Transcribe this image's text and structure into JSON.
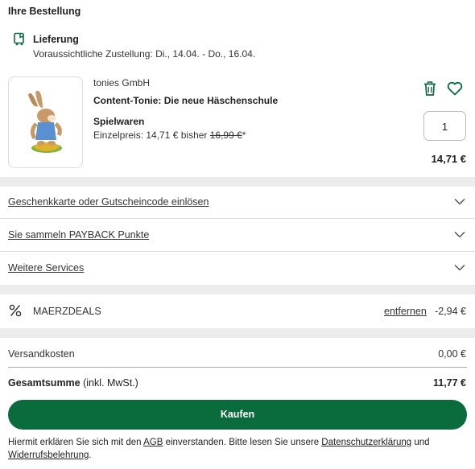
{
  "order": {
    "title": "Ihre Bestellung",
    "delivery_title": "Lieferung",
    "delivery_date": "Voraussichtliche Zustellung: Di., 14.04. - Do., 16.04."
  },
  "product": {
    "vendor": "tonies GmbH",
    "name": "Content-Tonie: Die neue Häschenschule",
    "category": "Spielwaren",
    "unit_price_prefix": "Einzelpreis: 14,71 € bisher ",
    "old_price": "16,99 €",
    "old_price_suffix": "*",
    "quantity": "1",
    "total": "14,71 €"
  },
  "accordions": [
    {
      "label": "Geschenkkarte oder Gutscheincode einlösen"
    },
    {
      "label": "Sie sammeln PAYBACK Punkte"
    },
    {
      "label": "Weitere Services"
    }
  ],
  "coupon": {
    "code": "MAERZDEALS",
    "remove_label": "entfernen",
    "value": "-2,94 €"
  },
  "summary": {
    "shipping_label": "Versandkosten",
    "shipping_value": "0,00 €",
    "total_label": "Gesamtsumme",
    "total_note": " (inkl. MwSt.)",
    "total_value": "11,77 €"
  },
  "buy_label": "Kaufen",
  "legal": {
    "part1": "Hiermit erklären Sie sich mit den ",
    "agb": "AGB",
    "part2": " einverstanden. Bitte lesen Sie unsere ",
    "privacy": "Datenschutzerklärung",
    "part3": " und ",
    "withdrawal": "Widerrufsbelehrung",
    "part4": "."
  },
  "colors": {
    "accent": "#0a6b3d",
    "separator": "#ececec"
  }
}
